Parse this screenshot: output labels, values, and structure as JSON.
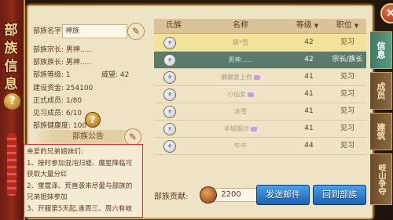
{
  "banner": {
    "title": "部族信息",
    "help": "?"
  },
  "window": {
    "close": "×"
  },
  "info": {
    "name_label": "部族名字:",
    "name_value": "神族",
    "chief_label": "部族宗长:",
    "chief_value": "男神.....",
    "deputy_label": "部族族长:",
    "deputy_value": "男神.....",
    "level_label": "部族等级:",
    "level_value": "1",
    "prestige_label": "威望:",
    "prestige_value": "42",
    "funds_label": "建设资金:",
    "funds_value": "254100",
    "members_label": "正式成员:",
    "members_value": "1/80",
    "trainees_label": "见习成员:",
    "trainees_value": "6/10",
    "health_label": "部族健康度:",
    "health_value": "100",
    "help": "?"
  },
  "notice": {
    "title": "部族公告",
    "lines": [
      "亲爱的兄弟姐妹们:",
      "1、按时参加混沌归墟、魔星降临可",
      "获取大量分红",
      "2、雷霆泽、荒兽袭来尽量与部族的",
      "兄弟姐妹参加",
      "3、开服第5天起,逢周三、周六有岐"
    ]
  },
  "table": {
    "headers": {
      "clan": "氏族",
      "name": "名称",
      "level": "等级",
      "position": "职位"
    },
    "rows": [
      {
        "name": "飘*雪",
        "level": "42",
        "position": "见习"
      },
      {
        "name": "男神......",
        "level": "42",
        "position": "宗长/族长"
      },
      {
        "name": "偏偏爱上你",
        "level": "41",
        "position": "见习"
      },
      {
        "name": "小仙女",
        "level": "41",
        "position": "见习"
      },
      {
        "name": "冰雪",
        "level": "41",
        "position": "见习"
      },
      {
        "name": "半城烟沙",
        "level": "41",
        "position": "见习"
      },
      {
        "name": "牛牛",
        "level": "44",
        "position": "见习"
      }
    ]
  },
  "bottom": {
    "contrib_label": "部族贡献:",
    "contrib_value": "2200",
    "send_mail": "发送邮件",
    "return_clan": "回到部族"
  },
  "tabs": [
    {
      "label": "信息"
    },
    {
      "label": "成员"
    },
    {
      "label": "建筑"
    },
    {
      "label": "岐山争夺"
    }
  ],
  "colors": {
    "selected_row": "#f3e29a",
    "leader_row": "#5b7a6b",
    "button_blue": "#1c62b4",
    "notice_border": "#d73a2a"
  }
}
